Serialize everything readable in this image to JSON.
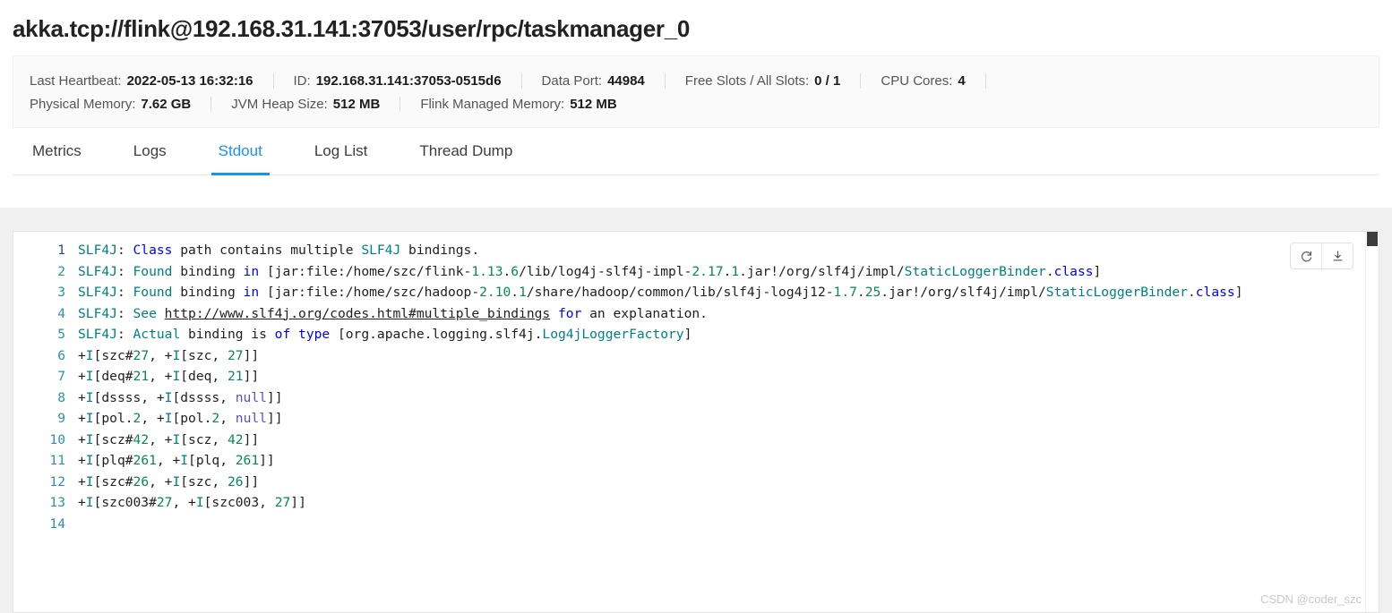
{
  "page_title": "akka.tcp://flink@192.168.31.141:37053/user/rpc/taskmanager_0",
  "info_panel": {
    "row1": [
      {
        "label": "Last Heartbeat:",
        "value": "2022-05-13 16:32:16"
      },
      {
        "label": "ID:",
        "value": "192.168.31.141:37053-0515d6"
      },
      {
        "label": "Data Port:",
        "value": "44984"
      },
      {
        "label": "Free Slots / All Slots:",
        "value": "0 / 1"
      },
      {
        "label": "CPU Cores:",
        "value": "4"
      }
    ],
    "row2": [
      {
        "label": "Physical Memory:",
        "value": "7.62 GB"
      },
      {
        "label": "JVM Heap Size:",
        "value": "512 MB"
      },
      {
        "label": "Flink Managed Memory:",
        "value": "512 MB"
      }
    ]
  },
  "tabs": [
    {
      "label": "Metrics",
      "active": false
    },
    {
      "label": "Logs",
      "active": false
    },
    {
      "label": "Stdout",
      "active": true
    },
    {
      "label": "Log List",
      "active": false
    },
    {
      "label": "Thread Dump",
      "active": false
    }
  ],
  "toolbar": {
    "refresh_label": "Refresh",
    "download_label": "Download"
  },
  "accent_color": "#1890ff",
  "stdout": {
    "lines": [
      {
        "number": "1",
        "current": true,
        "tokens": [
          {
            "t": "SLF4J",
            "c": "teal"
          },
          {
            "t": ": ",
            "c": "plain"
          },
          {
            "t": "Class",
            "c": "blue"
          },
          {
            "t": " path contains multiple ",
            "c": "plain"
          },
          {
            "t": "SLF4J",
            "c": "teal"
          },
          {
            "t": " bindings.",
            "c": "plain"
          }
        ]
      },
      {
        "number": "2",
        "current": false,
        "tokens": [
          {
            "t": "SLF4J",
            "c": "teal"
          },
          {
            "t": ": ",
            "c": "plain"
          },
          {
            "t": "Found",
            "c": "teal"
          },
          {
            "t": " binding ",
            "c": "plain"
          },
          {
            "t": "in",
            "c": "blue"
          },
          {
            "t": " [jar:file:/home/szc/flink-",
            "c": "plain"
          },
          {
            "t": "1.13",
            "c": "green"
          },
          {
            "t": ".",
            "c": "plain"
          },
          {
            "t": "6",
            "c": "green"
          },
          {
            "t": "/lib/log4j-slf4j-impl-",
            "c": "plain"
          },
          {
            "t": "2.17",
            "c": "green"
          },
          {
            "t": ".",
            "c": "plain"
          },
          {
            "t": "1",
            "c": "green"
          },
          {
            "t": ".jar!/org/slf4j/impl/",
            "c": "plain"
          },
          {
            "t": "StaticLoggerBinder",
            "c": "teal"
          },
          {
            "t": ".",
            "c": "plain"
          },
          {
            "t": "class",
            "c": "blue"
          },
          {
            "t": "]",
            "c": "plain"
          }
        ]
      },
      {
        "number": "3",
        "current": false,
        "tokens": [
          {
            "t": "SLF4J",
            "c": "teal"
          },
          {
            "t": ": ",
            "c": "plain"
          },
          {
            "t": "Found",
            "c": "teal"
          },
          {
            "t": " binding ",
            "c": "plain"
          },
          {
            "t": "in",
            "c": "blue"
          },
          {
            "t": " [jar:file:/home/szc/hadoop-",
            "c": "plain"
          },
          {
            "t": "2.10",
            "c": "green"
          },
          {
            "t": ".",
            "c": "plain"
          },
          {
            "t": "1",
            "c": "green"
          },
          {
            "t": "/share/hadoop/common/lib/slf4j-log4j12-",
            "c": "plain"
          },
          {
            "t": "1.7",
            "c": "green"
          },
          {
            "t": ".",
            "c": "plain"
          },
          {
            "t": "25",
            "c": "green"
          },
          {
            "t": ".jar!/org/slf4j/impl/",
            "c": "plain"
          },
          {
            "t": "StaticLoggerBinder",
            "c": "teal"
          },
          {
            "t": ".",
            "c": "plain"
          },
          {
            "t": "class",
            "c": "blue"
          },
          {
            "t": "]",
            "c": "plain"
          }
        ]
      },
      {
        "number": "4",
        "current": false,
        "tokens": [
          {
            "t": "SLF4J",
            "c": "teal"
          },
          {
            "t": ": ",
            "c": "plain"
          },
          {
            "t": "See",
            "c": "teal"
          },
          {
            "t": " ",
            "c": "plain"
          },
          {
            "t": "http://www.slf4j.org/codes.html#multiple_bindings",
            "c": "url"
          },
          {
            "t": " ",
            "c": "plain"
          },
          {
            "t": "for",
            "c": "blue"
          },
          {
            "t": " an explanation.",
            "c": "plain"
          }
        ]
      },
      {
        "number": "5",
        "current": false,
        "tokens": [
          {
            "t": "SLF4J",
            "c": "teal"
          },
          {
            "t": ": ",
            "c": "plain"
          },
          {
            "t": "Actual",
            "c": "teal"
          },
          {
            "t": " binding is ",
            "c": "plain"
          },
          {
            "t": "of type",
            "c": "blue"
          },
          {
            "t": " [org.apache.logging.slf4j.",
            "c": "plain"
          },
          {
            "t": "Log4jLoggerFactory",
            "c": "teal"
          },
          {
            "t": "]",
            "c": "plain"
          }
        ]
      },
      {
        "number": "6",
        "current": false,
        "tokens": [
          {
            "t": "+",
            "c": "plain"
          },
          {
            "t": "I",
            "c": "teal"
          },
          {
            "t": "[szc#",
            "c": "plain"
          },
          {
            "t": "27",
            "c": "green"
          },
          {
            "t": ", +",
            "c": "plain"
          },
          {
            "t": "I",
            "c": "teal"
          },
          {
            "t": "[szc, ",
            "c": "plain"
          },
          {
            "t": "27",
            "c": "green"
          },
          {
            "t": "]]",
            "c": "plain"
          }
        ]
      },
      {
        "number": "7",
        "current": false,
        "tokens": [
          {
            "t": "+",
            "c": "plain"
          },
          {
            "t": "I",
            "c": "teal"
          },
          {
            "t": "[deq#",
            "c": "plain"
          },
          {
            "t": "21",
            "c": "green"
          },
          {
            "t": ", +",
            "c": "plain"
          },
          {
            "t": "I",
            "c": "teal"
          },
          {
            "t": "[deq, ",
            "c": "plain"
          },
          {
            "t": "21",
            "c": "green"
          },
          {
            "t": "]]",
            "c": "plain"
          }
        ]
      },
      {
        "number": "8",
        "current": false,
        "tokens": [
          {
            "t": "+",
            "c": "plain"
          },
          {
            "t": "I",
            "c": "teal"
          },
          {
            "t": "[dssss, +",
            "c": "plain"
          },
          {
            "t": "I",
            "c": "teal"
          },
          {
            "t": "[dssss, ",
            "c": "plain"
          },
          {
            "t": "null",
            "c": "purple"
          },
          {
            "t": "]]",
            "c": "plain"
          }
        ]
      },
      {
        "number": "9",
        "current": false,
        "tokens": [
          {
            "t": "+",
            "c": "plain"
          },
          {
            "t": "I",
            "c": "teal"
          },
          {
            "t": "[pol.",
            "c": "plain"
          },
          {
            "t": "2",
            "c": "green"
          },
          {
            "t": ", +",
            "c": "plain"
          },
          {
            "t": "I",
            "c": "teal"
          },
          {
            "t": "[pol.",
            "c": "plain"
          },
          {
            "t": "2",
            "c": "green"
          },
          {
            "t": ", ",
            "c": "plain"
          },
          {
            "t": "null",
            "c": "purple"
          },
          {
            "t": "]]",
            "c": "plain"
          }
        ]
      },
      {
        "number": "10",
        "current": false,
        "tokens": [
          {
            "t": "+",
            "c": "plain"
          },
          {
            "t": "I",
            "c": "teal"
          },
          {
            "t": "[scz#",
            "c": "plain"
          },
          {
            "t": "42",
            "c": "green"
          },
          {
            "t": ", +",
            "c": "plain"
          },
          {
            "t": "I",
            "c": "teal"
          },
          {
            "t": "[scz, ",
            "c": "plain"
          },
          {
            "t": "42",
            "c": "green"
          },
          {
            "t": "]]",
            "c": "plain"
          }
        ]
      },
      {
        "number": "11",
        "current": false,
        "tokens": [
          {
            "t": "+",
            "c": "plain"
          },
          {
            "t": "I",
            "c": "teal"
          },
          {
            "t": "[plq#",
            "c": "plain"
          },
          {
            "t": "261",
            "c": "green"
          },
          {
            "t": ", +",
            "c": "plain"
          },
          {
            "t": "I",
            "c": "teal"
          },
          {
            "t": "[plq, ",
            "c": "plain"
          },
          {
            "t": "261",
            "c": "green"
          },
          {
            "t": "]]",
            "c": "plain"
          }
        ]
      },
      {
        "number": "12",
        "current": false,
        "tokens": [
          {
            "t": "+",
            "c": "plain"
          },
          {
            "t": "I",
            "c": "teal"
          },
          {
            "t": "[szc#",
            "c": "plain"
          },
          {
            "t": "26",
            "c": "green"
          },
          {
            "t": ", +",
            "c": "plain"
          },
          {
            "t": "I",
            "c": "teal"
          },
          {
            "t": "[szc, ",
            "c": "plain"
          },
          {
            "t": "26",
            "c": "green"
          },
          {
            "t": "]]",
            "c": "plain"
          }
        ]
      },
      {
        "number": "13",
        "current": false,
        "tokens": [
          {
            "t": "+",
            "c": "plain"
          },
          {
            "t": "I",
            "c": "teal"
          },
          {
            "t": "[szc003#",
            "c": "plain"
          },
          {
            "t": "27",
            "c": "green"
          },
          {
            "t": ", +",
            "c": "plain"
          },
          {
            "t": "I",
            "c": "teal"
          },
          {
            "t": "[szc003, ",
            "c": "plain"
          },
          {
            "t": "27",
            "c": "green"
          },
          {
            "t": "]]",
            "c": "plain"
          }
        ]
      },
      {
        "number": "14",
        "current": false,
        "tokens": []
      }
    ]
  },
  "watermark": "CSDN @coder_szc"
}
